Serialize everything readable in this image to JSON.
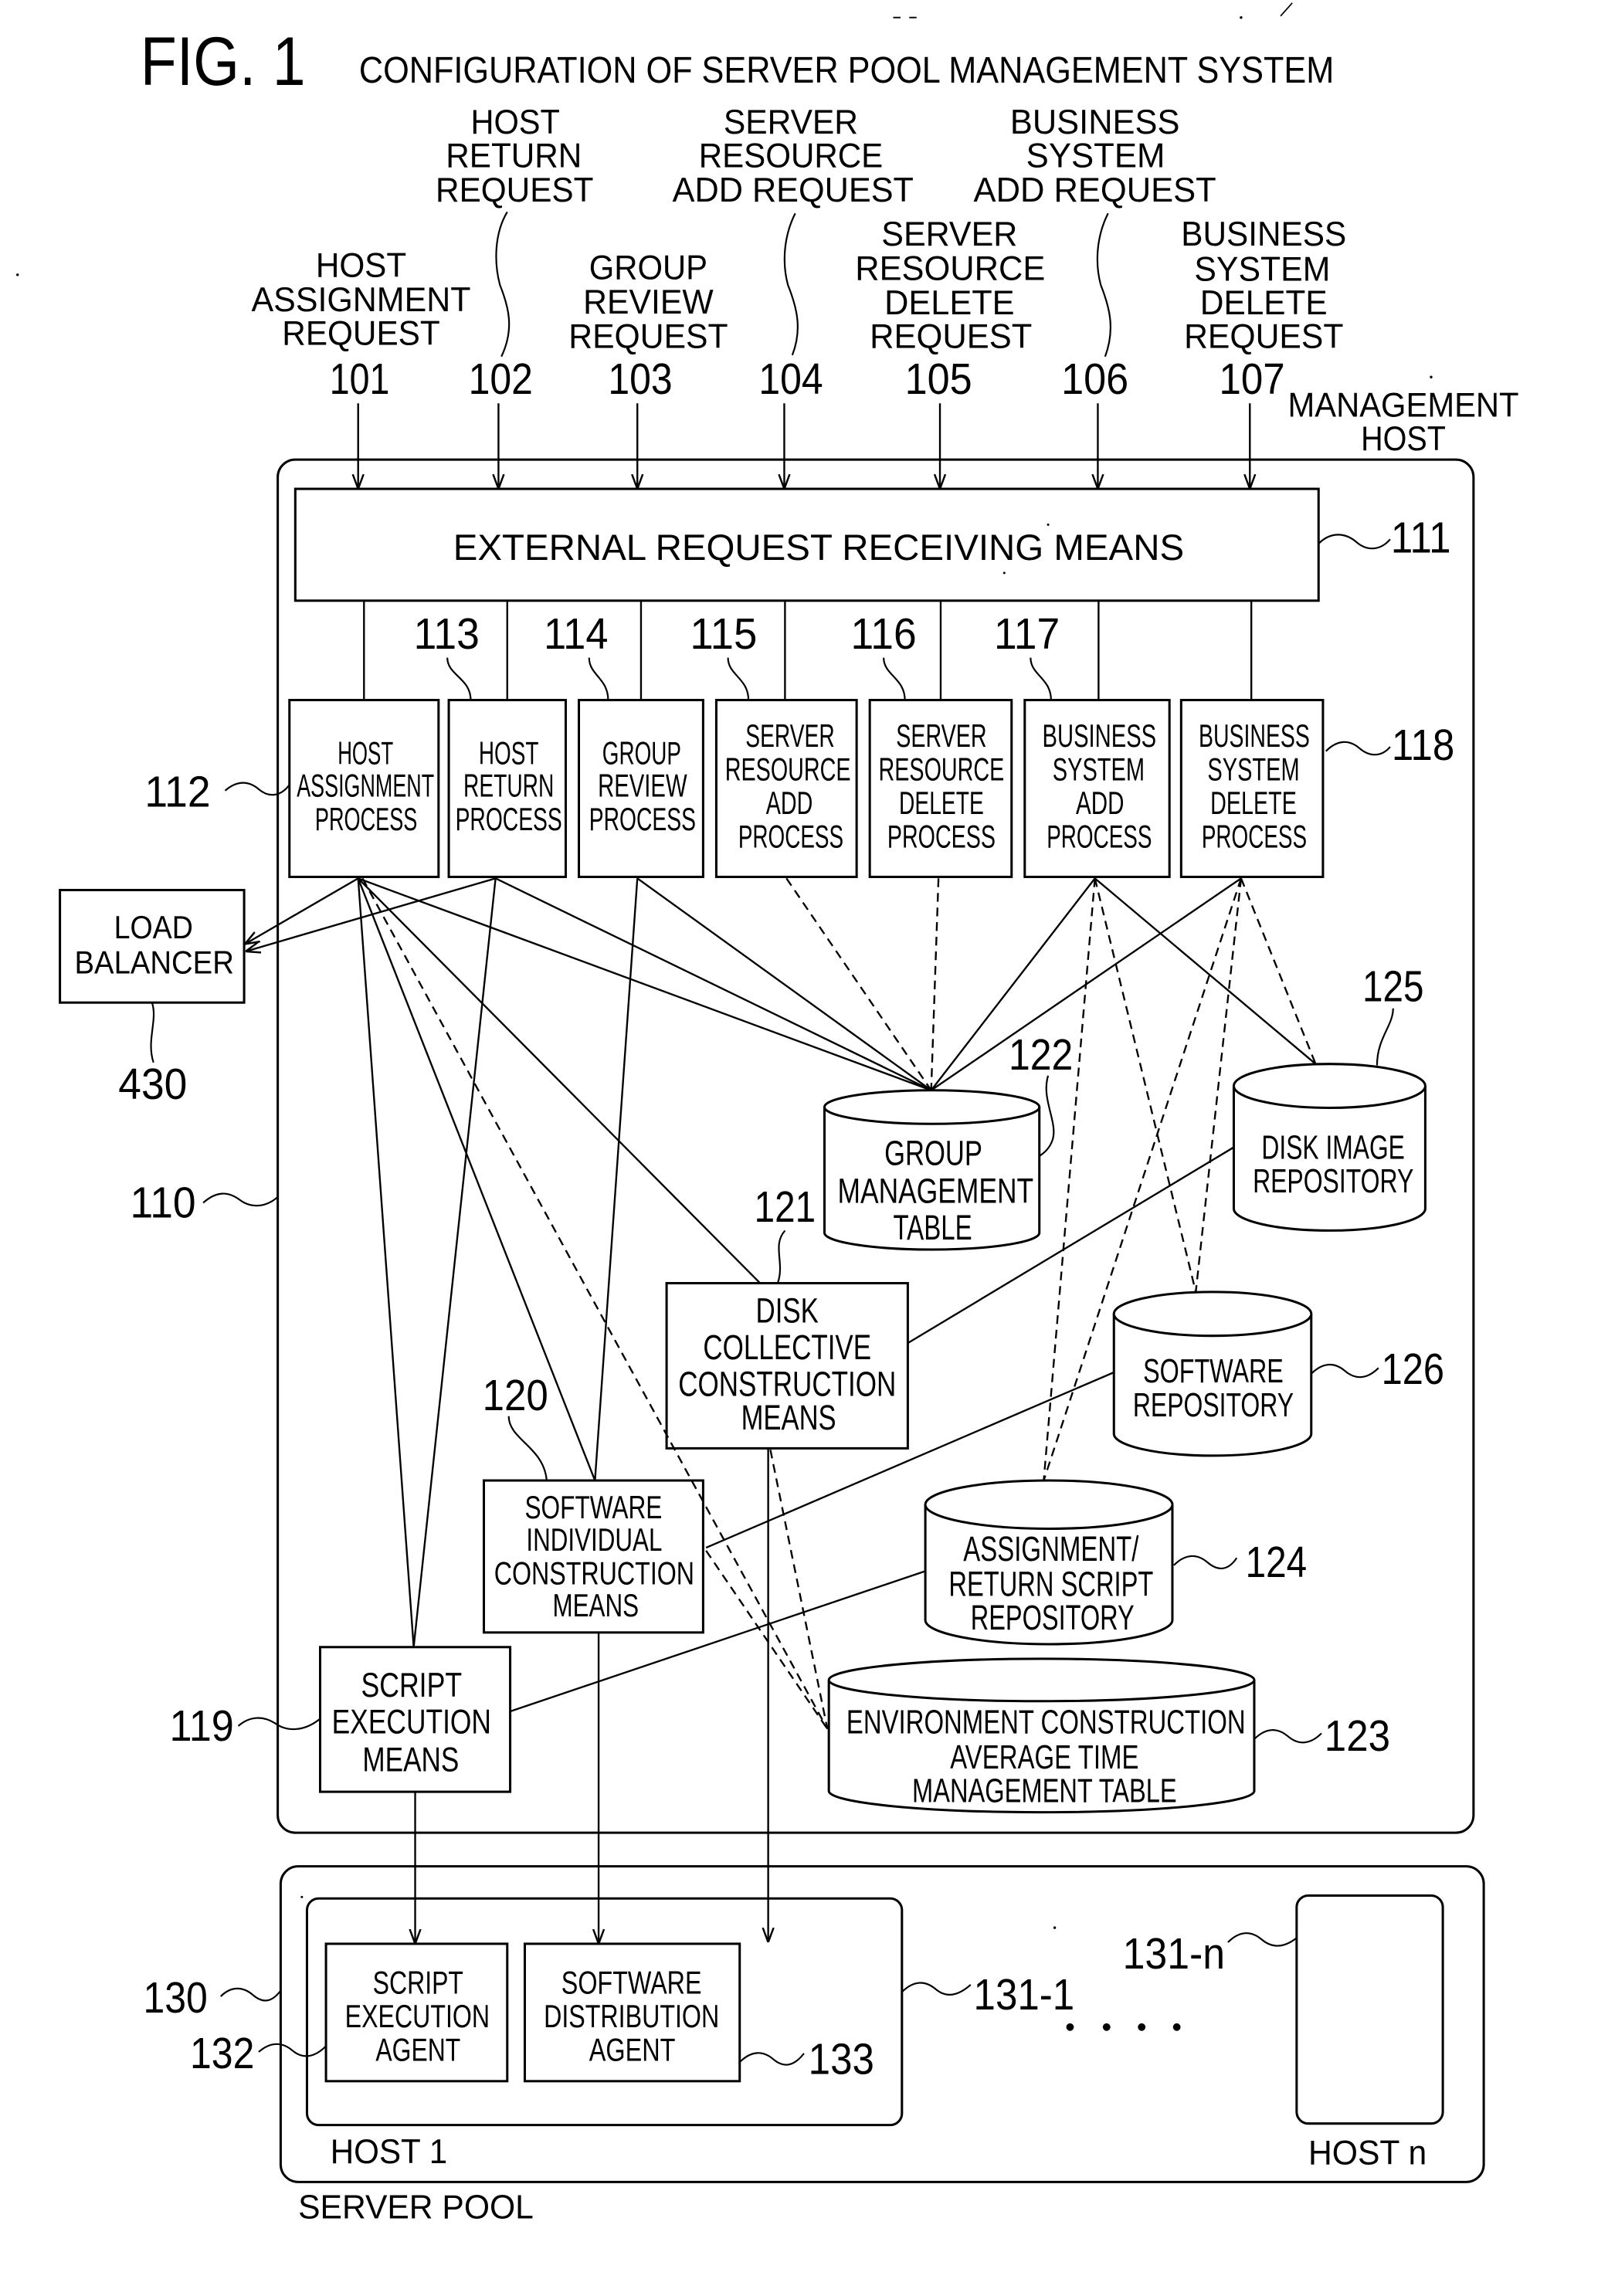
{
  "figure": {
    "number": "FIG. 1",
    "title": "CONFIGURATION OF SERVER POOL MANAGEMENT SYSTEM"
  },
  "colors": {
    "ink": "#000000",
    "paper": "#ffffff"
  },
  "requests": [
    {
      "ref": "101",
      "lines": [
        "HOST",
        "ASSIGNMENT",
        "REQUEST"
      ]
    },
    {
      "ref": "102",
      "lines": [
        "HOST",
        "RETURN",
        "REQUEST"
      ]
    },
    {
      "ref": "103",
      "lines": [
        "GROUP",
        "REVIEW",
        "REQUEST"
      ]
    },
    {
      "ref": "104",
      "lines": [
        "SERVER",
        "RESOURCE",
        "ADD REQUEST"
      ]
    },
    {
      "ref": "105",
      "lines": [
        "SERVER",
        "RESOURCE",
        "DELETE",
        "REQUEST"
      ]
    },
    {
      "ref": "106",
      "lines": [
        "BUSINESS",
        "SYSTEM",
        "ADD REQUEST"
      ]
    },
    {
      "ref": "107",
      "lines": [
        "BUSINESS",
        "SYSTEM",
        "DELETE",
        "REQUEST"
      ]
    }
  ],
  "management_host": {
    "ref": "110",
    "lines": [
      "MANAGEMENT",
      "HOST"
    ]
  },
  "external_request_receiving_means": {
    "ref": "111",
    "label": "EXTERNAL REQUEST RECEIVING MEANS"
  },
  "processes": [
    {
      "ref": "112",
      "lines": [
        "HOST",
        "ASSIGNMENT",
        "PROCESS"
      ]
    },
    {
      "ref": "113",
      "lines": [
        "HOST",
        "RETURN",
        "PROCESS"
      ]
    },
    {
      "ref": "114",
      "lines": [
        "GROUP",
        "REVIEW",
        "PROCESS"
      ]
    },
    {
      "ref": "115",
      "lines": [
        "SERVER",
        "RESOURCE",
        "ADD",
        "PROCESS"
      ]
    },
    {
      "ref": "116",
      "lines": [
        "SERVER",
        "RESOURCE",
        "DELETE",
        "PROCESS"
      ]
    },
    {
      "ref": "117",
      "lines": [
        "BUSINESS",
        "SYSTEM",
        "ADD",
        "PROCESS"
      ]
    },
    {
      "ref": "118",
      "lines": [
        "BUSINESS",
        "SYSTEM",
        "DELETE",
        "PROCESS"
      ]
    }
  ],
  "means": {
    "script_execution": {
      "ref": "119",
      "lines": [
        "SCRIPT",
        "EXECUTION",
        "MEANS"
      ]
    },
    "software_individual_construction": {
      "ref": "120",
      "lines": [
        "SOFTWARE",
        "INDIVIDUAL",
        "CONSTRUCTION",
        "MEANS"
      ]
    },
    "disk_collective_construction": {
      "ref": "121",
      "lines": [
        "DISK",
        "COLLECTIVE",
        "CONSTRUCTION",
        "MEANS"
      ]
    }
  },
  "stores": {
    "group_management_table": {
      "ref": "122",
      "lines": [
        "GROUP",
        "MANAGEMENT",
        "TABLE"
      ]
    },
    "environment_construction_table": {
      "ref": "123",
      "lines": [
        "ENVIRONMENT CONSTRUCTION",
        "AVERAGE TIME",
        "MANAGEMENT TABLE"
      ]
    },
    "assignment_return_script_repository": {
      "ref": "124",
      "lines": [
        "ASSIGNMENT/",
        "RETURN SCRIPT",
        "REPOSITORY"
      ]
    },
    "disk_image_repository": {
      "ref": "125",
      "lines": [
        "DISK IMAGE",
        "REPOSITORY"
      ]
    },
    "software_repository": {
      "ref": "126",
      "lines": [
        "SOFTWARE",
        "REPOSITORY"
      ]
    }
  },
  "server_pool": {
    "ref": "130",
    "label": "SERVER POOL",
    "host_1": {
      "ref": "131-1",
      "label": "HOST 1",
      "script_execution_agent": {
        "ref": "132",
        "lines": [
          "SCRIPT",
          "EXECUTION",
          "AGENT"
        ]
      },
      "software_distribution_agent": {
        "ref": "133",
        "lines": [
          "SOFTWARE",
          "DISTRIBUTION",
          "AGENT"
        ]
      }
    },
    "host_n": {
      "ref": "131-n",
      "label": "HOST n"
    }
  },
  "load_balancer": {
    "ref": "430",
    "lines": [
      "LOAD",
      "BALANCER"
    ]
  }
}
